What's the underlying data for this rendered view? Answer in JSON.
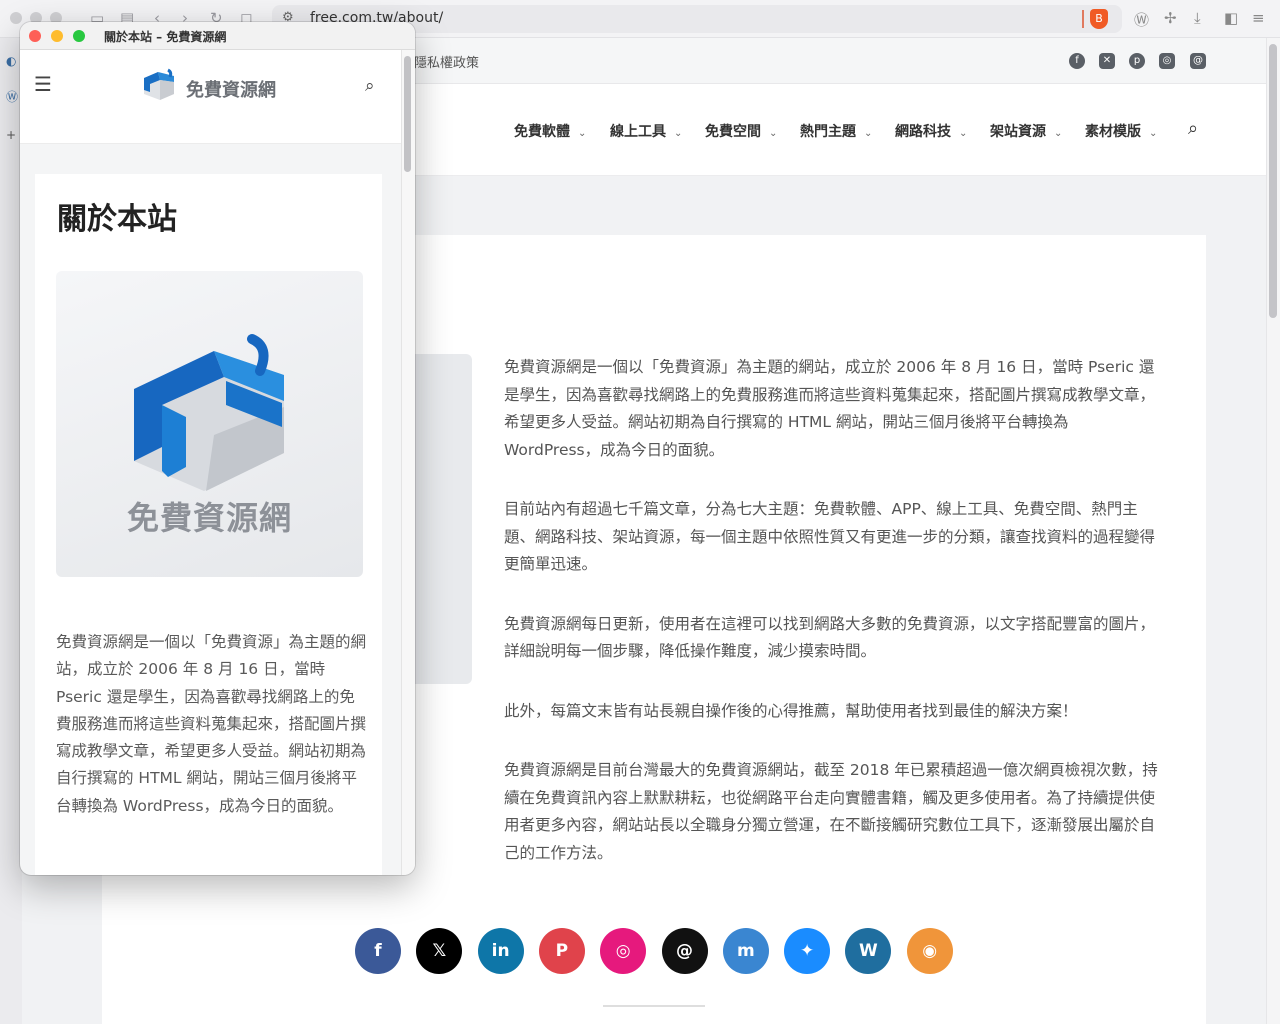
{
  "browser": {
    "url": "free.com.tw/about/",
    "brave_badge": "B"
  },
  "site": {
    "top_link": "隱私權政策",
    "nav": [
      {
        "label": "免費軟體"
      },
      {
        "label": "線上工具"
      },
      {
        "label": "免費空間"
      },
      {
        "label": "熱門主題"
      },
      {
        "label": "網路科技"
      },
      {
        "label": "架站資源"
      },
      {
        "label": "素材模版"
      }
    ],
    "article": [
      "免費資源網是一個以「免費資源」為主題的網站，成立於 2006 年 8 月 16 日，當時 Pseric 還是學生，因為喜歡尋找網路上的免費服務進而將這些資料蒐集起來，搭配圖片撰寫成教學文章，希望更多人受益。網站初期為自行撰寫的 HTML 網站，開站三個月後將平台轉換為 WordPress，成為今日的面貌。",
      "目前站內有超過七千篇文章，分為七大主題：免費軟體、APP、線上工具、免費空間、熱門主題、網路科技、架站資源，每一個主題中依照性質又有更進一步的分類，讓查找資料的過程變得更簡單迅速。",
      "免費資源網每日更新，使用者在這裡可以找到網路大多數的免費資源，以文字搭配豐富的圖片，詳細說明每一個步驟，降低操作難度，減少摸索時間。",
      "此外，每篇文末皆有站長親自操作後的心得推薦，幫助使用者找到最佳的解決方案！",
      "免費資源網是目前台灣最大的免費資源網站，截至 2018 年已累積超過一億次網頁檢視次數，持續在免費資訊內容上默默耕耘，也從網路平台走向實體書籍，觸及更多使用者。為了持續提供使用者更多內容，網站站長以全職身分獨立營運，在不斷接觸研究數位工具下，逐漸發展出屬於自己的工作方法。"
    ],
    "share_buttons": [
      {
        "icon": "facebook-icon",
        "glyph": "f",
        "color": "#3b5998"
      },
      {
        "icon": "x-icon",
        "glyph": "𝕏",
        "color": "#000000"
      },
      {
        "icon": "linkedin-icon",
        "glyph": "in",
        "color": "#0e76a8"
      },
      {
        "icon": "pinterest-icon",
        "glyph": "P",
        "color": "#e0434b"
      },
      {
        "icon": "instagram-icon",
        "glyph": "◎",
        "color": "#e6197d"
      },
      {
        "icon": "threads-icon",
        "glyph": "@",
        "color": "#111111"
      },
      {
        "icon": "mastodon-icon",
        "glyph": "m",
        "color": "#3a86d1"
      },
      {
        "icon": "bluesky-icon",
        "glyph": "✦",
        "color": "#1a8cff"
      },
      {
        "icon": "wordpress-icon",
        "glyph": "W",
        "color": "#1f6e9f"
      },
      {
        "icon": "rss-icon",
        "glyph": "◉",
        "color": "#f0953a"
      }
    ]
  },
  "popup": {
    "window_title": "關於本站 – 免費資源網",
    "brand": "免費資源網",
    "page_title": "關於本站",
    "hero_text": "免費資源網",
    "paragraph": "免費資源網是一個以「免費資源」為主題的網站，成立於 2006 年 8 月 16 日，當時 Pseric 還是學生，因為喜歡尋找網路上的免費服務進而將這些資料蒐集起來，搭配圖片撰寫成教學文章，希望更多人受益。網站初期為自行撰寫的 HTML 網站，開站三個月後將平台轉換為 WordPress，成為今日的面貌。"
  }
}
